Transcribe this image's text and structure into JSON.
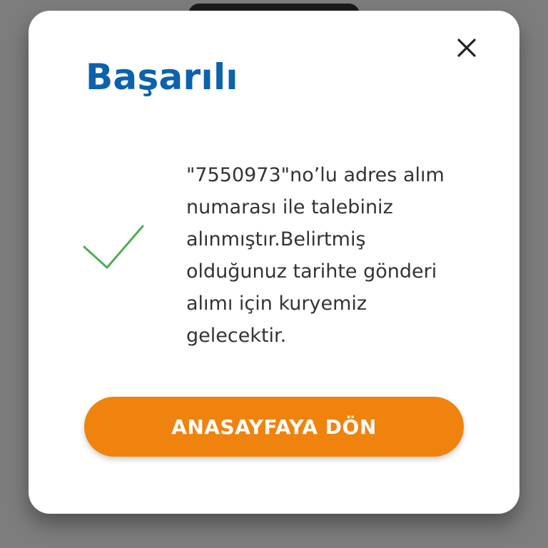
{
  "dialog": {
    "title": "Başarılı",
    "message": "\"7550973\"no’lu adres alım\nnumarası ile talebiniz\nalınmıştır.Belirtmiş\nolduğunuz tarihte gönderi\nalımı için kuryemiz\ngelecektir.",
    "close_icon": "close-icon",
    "status_icon": "checkmark-icon",
    "button_label": "ANASAYFAYA DÖN"
  },
  "colors": {
    "title": "#0c62ad",
    "checkmark": "#4caf50",
    "button": "#f0830d",
    "button_text": "#ffffff",
    "overlay": "#7d7d7d"
  }
}
